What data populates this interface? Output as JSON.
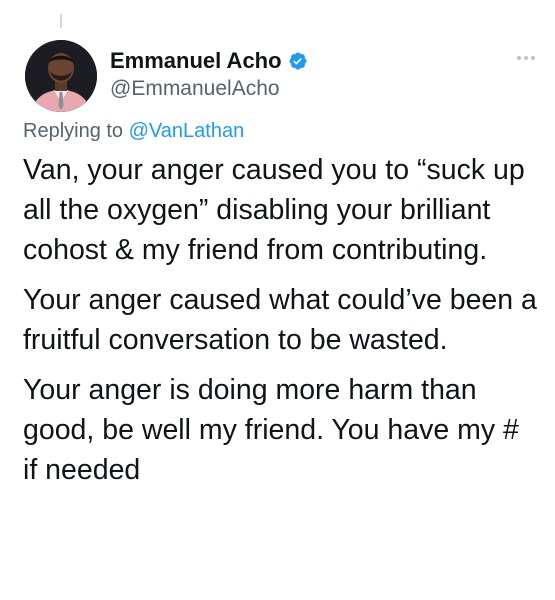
{
  "author": {
    "display_name": "Emmanuel Acho",
    "handle": "@EmmanuelAcho",
    "verified": true
  },
  "reply": {
    "prefix": "Replying to",
    "target_handle": "@VanLathan"
  },
  "tweet": {
    "paragraphs": [
      "Van, your anger caused you to “suck up all the oxygen” disabling your brilliant cohost & my friend from contributing.",
      "Your anger caused what could’ve been a fruitful conversation to be wasted.",
      "Your anger is doing more harm than good, be well my friend. You have my # if needed"
    ]
  },
  "colors": {
    "link": "#1d9bf0",
    "secondary_text": "#536471",
    "primary_text": "#0f1419",
    "verified_badge": "#1d9bf0"
  },
  "icons": {
    "verified": "verified-badge-icon",
    "more": "more-options-icon"
  }
}
